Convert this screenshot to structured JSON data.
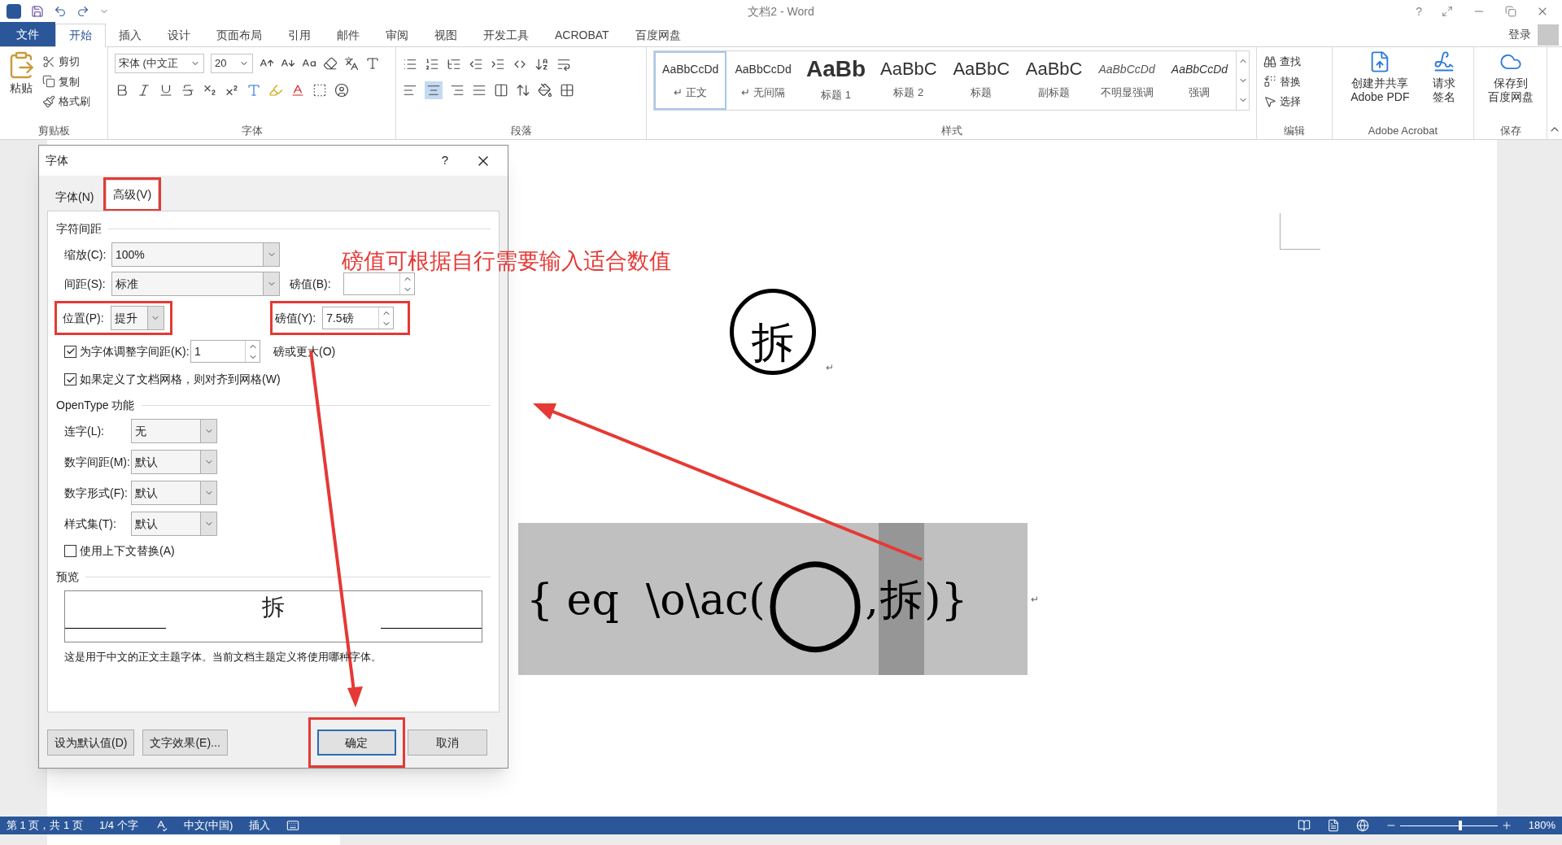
{
  "title_bar": {
    "title": "文档2 - Word",
    "help": "?"
  },
  "menu_tabs": [
    {
      "label": "文件",
      "kind": "file",
      "selected": false
    },
    {
      "label": "开始",
      "kind": "tab",
      "selected": true
    },
    {
      "label": "插入",
      "kind": "tab",
      "selected": false
    },
    {
      "label": "设计",
      "kind": "tab",
      "selected": false
    },
    {
      "label": "页面布局",
      "kind": "tab",
      "selected": false
    },
    {
      "label": "引用",
      "kind": "tab",
      "selected": false
    },
    {
      "label": "邮件",
      "kind": "tab",
      "selected": false
    },
    {
      "label": "审阅",
      "kind": "tab",
      "selected": false
    },
    {
      "label": "视图",
      "kind": "tab",
      "selected": false
    },
    {
      "label": "开发工具",
      "kind": "tab",
      "selected": false
    },
    {
      "label": "ACROBAT",
      "kind": "tab",
      "selected": false
    },
    {
      "label": "百度网盘",
      "kind": "tab",
      "selected": false
    }
  ],
  "account": {
    "label": "登录"
  },
  "ribbon": {
    "clipboard": {
      "paste": "粘贴",
      "items": [
        "剪切",
        "复制",
        "格式刷"
      ],
      "label": "剪贴板"
    },
    "font": {
      "font_name": "宋体 (中文正",
      "font_size": "20",
      "label": "字体"
    },
    "paragraph": {
      "label": "段落"
    },
    "styles": {
      "label": "样式",
      "items": [
        {
          "preview": "AaBbCcDd",
          "name": "↵ 正文",
          "kind": "normal",
          "selected": true
        },
        {
          "preview": "AaBbCcDd",
          "name": "↵ 无间隔",
          "kind": "normal",
          "selected": false
        },
        {
          "preview": "AaBb",
          "name": "标题 1",
          "kind": "heading1",
          "selected": false
        },
        {
          "preview": "AaBbC",
          "name": "标题 2",
          "kind": "heading2",
          "selected": false
        },
        {
          "preview": "AaBbC",
          "name": "标题",
          "kind": "title",
          "selected": false
        },
        {
          "preview": "AaBbC",
          "name": "副标题",
          "kind": "title",
          "selected": false
        },
        {
          "preview": "AaBbCcDd",
          "name": "不明显强调",
          "kind": "subtle",
          "selected": false
        },
        {
          "preview": "AaBbCcDd",
          "name": "强调",
          "kind": "emphasis",
          "selected": false
        }
      ]
    },
    "editing": {
      "items": [
        "查找",
        "替换",
        "选择"
      ],
      "label": "编辑"
    },
    "acrobat": {
      "items": [
        [
          "创建并共享",
          "Adobe PDF"
        ],
        [
          "请求",
          "签名"
        ]
      ],
      "label": "Adobe Acrobat"
    },
    "save": {
      "lines": [
        "保存到",
        "百度网盘"
      ],
      "label": "保存"
    }
  },
  "document": {
    "enclosed_char": "拆",
    "para_mark": "↵",
    "field_code": {
      "before": "{ eq  \\o\\ac(",
      "enclosure": "◯",
      "separator": ",",
      "character": "拆",
      "after": ")}",
      "para_mark": "↵"
    }
  },
  "dialog": {
    "title": "字体",
    "help": "?",
    "tabs": [
      {
        "label": "字体(N)",
        "selected": false,
        "highlighted": false
      },
      {
        "label": "高级(V)",
        "selected": true,
        "highlighted": true
      }
    ],
    "spacing_section": "字符间距",
    "scale": {
      "label": "缩放(C):",
      "value": "100%"
    },
    "spacing": {
      "label": "间距(S):",
      "value": "标准"
    },
    "spacing_points": {
      "label": "磅值(B):"
    },
    "position": {
      "label": "位置(P):",
      "value": "提升",
      "highlighted": true
    },
    "position_points": {
      "label": "磅值(Y):",
      "value": "7.5磅",
      "highlighted": true
    },
    "kerning": {
      "label": "为字体调整字间距(K):",
      "checked": true,
      "value": "1",
      "suffix": "磅或更大(O)"
    },
    "snap_to_grid": {
      "label": "如果定义了文档网格，则对齐到网格(W)",
      "checked": true
    },
    "opentype_section": "OpenType 功能",
    "opentype": [
      {
        "label": "连字(L):",
        "value": "无"
      },
      {
        "label": "数字间距(M):",
        "value": "默认"
      },
      {
        "label": "数字形式(F):",
        "value": "默认"
      },
      {
        "label": "样式集(T):",
        "value": "默认"
      }
    ],
    "contextual": {
      "label": "使用上下文替换(A)",
      "checked": false
    },
    "preview_section": "预览",
    "preview_sample": "拆",
    "preview_note": "这是用于中文的正文主题字体。当前文档主题定义将使用哪种字体。",
    "buttons": [
      {
        "label": "设为默认值(D)",
        "default": false,
        "highlighted": false
      },
      {
        "label": "文字效果(E)...",
        "default": false,
        "highlighted": false
      },
      {
        "label": "确定",
        "default": true,
        "highlighted": true
      },
      {
        "label": "取消",
        "default": false,
        "highlighted": false
      }
    ]
  },
  "annotation": {
    "note": "磅值可根据自行需要输入适合数值"
  },
  "status_bar": {
    "items": [
      "第 1 页，共 1 页",
      "1/4 个字"
    ],
    "language": "中文(中国)",
    "mode": "插入",
    "zoom": "180%",
    "zoom_slider": {
      "level": 0.6
    }
  }
}
